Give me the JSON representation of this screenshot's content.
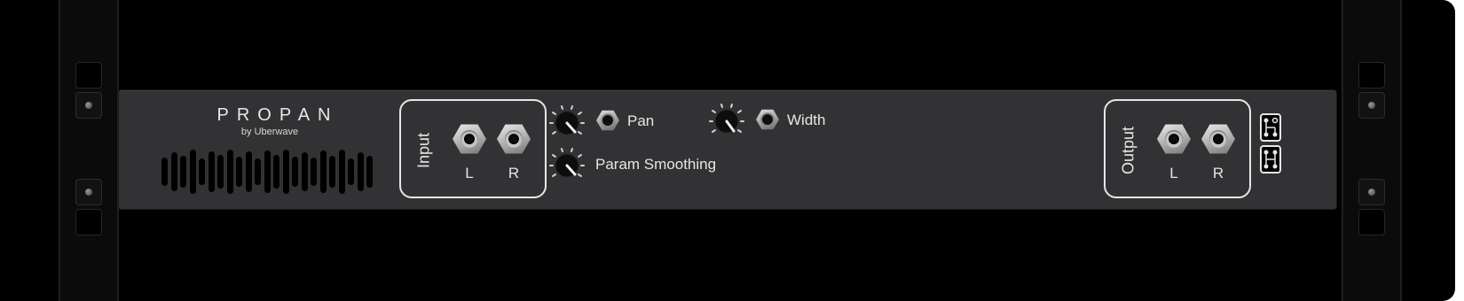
{
  "device": {
    "title": "PROPAN",
    "subtitle": "by Uberwave"
  },
  "grille": {
    "slot_heights": [
      32,
      44,
      36,
      50,
      30,
      46,
      38,
      50,
      34,
      46,
      30,
      48,
      38,
      50,
      34,
      44,
      32,
      48,
      36,
      50,
      30,
      44,
      36
    ]
  },
  "input": {
    "title": "Input",
    "left_label": "L",
    "right_label": "R"
  },
  "output": {
    "title": "Output",
    "left_label": "L",
    "right_label": "R"
  },
  "params": {
    "pan": {
      "label": "Pan"
    },
    "width": {
      "label": "Width"
    },
    "smoothing": {
      "label": "Param Smoothing"
    }
  },
  "icons": {
    "jack": "audio-jack-icon",
    "knob": "rotary-knob-icon",
    "routing_top": "routing-top-icon",
    "routing_bottom": "routing-bottom-icon",
    "screw": "rack-screw-icon"
  },
  "colors": {
    "panel": "#323234",
    "background": "#000000",
    "outline": "#e6e6e6",
    "text": "#e6e6e6"
  }
}
